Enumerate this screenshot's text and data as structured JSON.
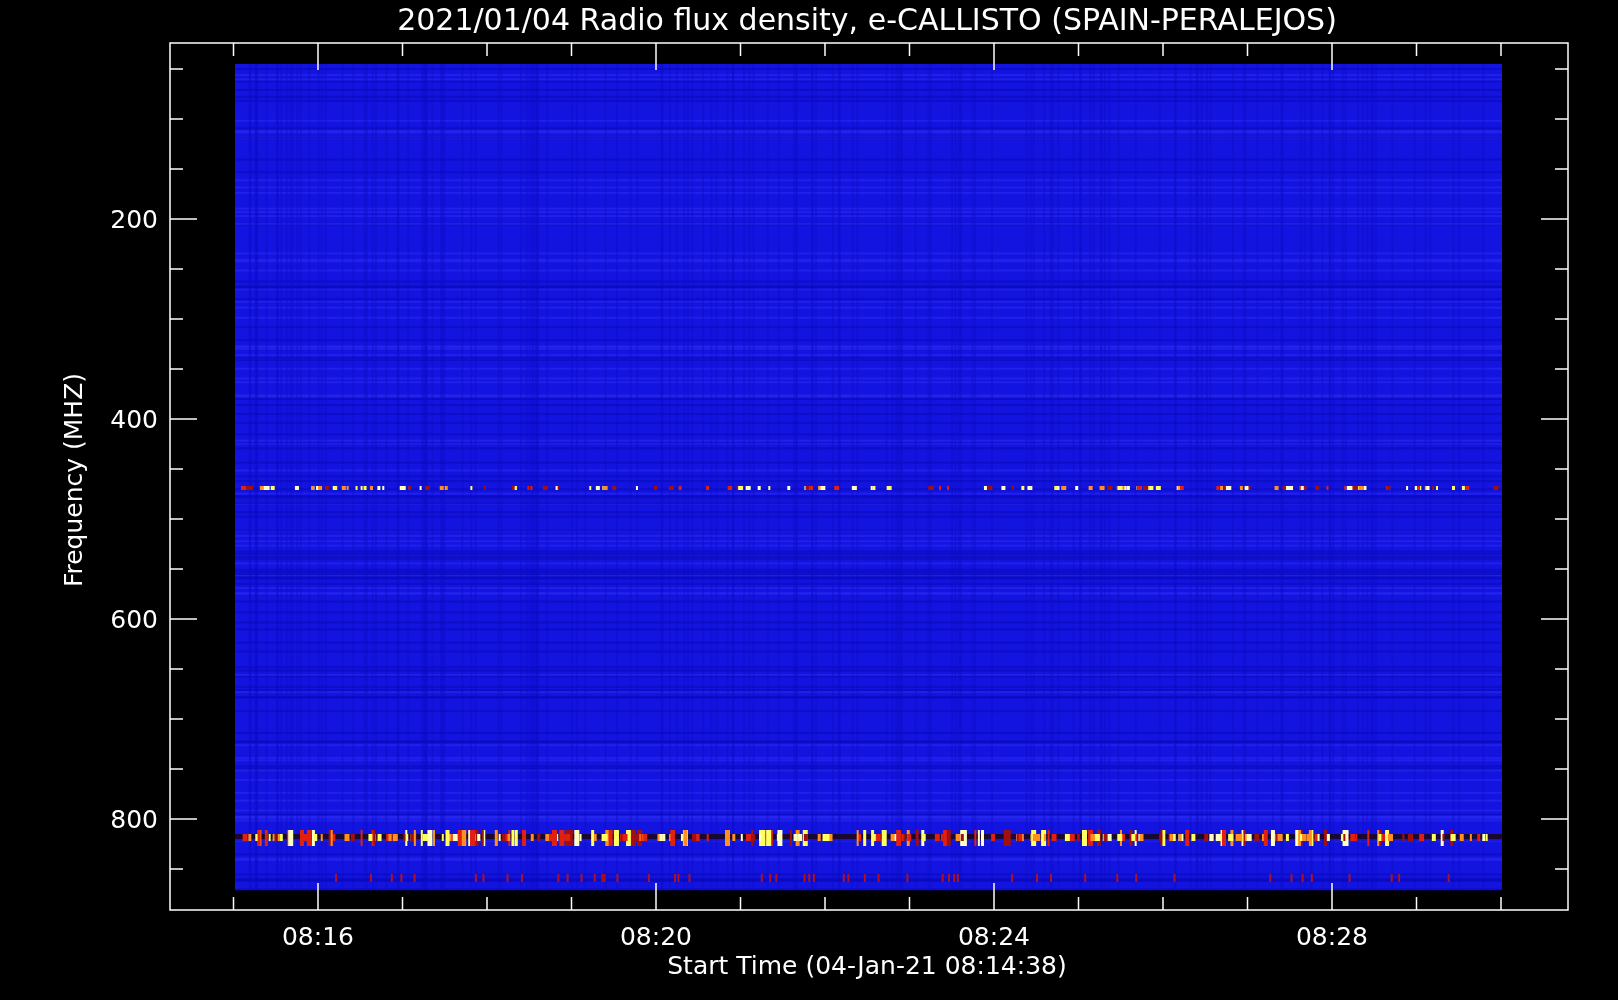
{
  "title": "2021/01/04  Radio flux density, e-CALLISTO (SPAIN-PERALEJOS)",
  "plot": {
    "ylabel": "Frequency (MHZ)",
    "xlabel": "Start Time (04-Jan-21 08:14:38)",
    "yticks": [
      "200",
      "400",
      "600",
      "800"
    ],
    "xticks": [
      "08:16",
      "08:20",
      "08:24",
      "08:28"
    ]
  }
}
